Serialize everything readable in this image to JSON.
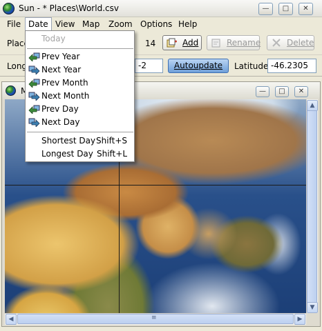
{
  "window": {
    "title": "Sun - * Places\\World.csv",
    "min_glyph": "—",
    "max_glyph": "□",
    "close_glyph": "✕"
  },
  "menubar": {
    "file": "File",
    "date": "Date",
    "view": "View",
    "map": "Map",
    "zoom": "Zoom",
    "options": "Options",
    "help": "Help"
  },
  "toolbar": {
    "place_label": "Place",
    "count": "14",
    "add_label": "Add",
    "rename_label": "Rename",
    "delete_label": "Delete"
  },
  "coords": {
    "longitude_label": "Long",
    "timezone_value": "-2",
    "autoupdate_label": "Autoupdate",
    "latitude_label": "Latitude",
    "latitude_value": "-46.2305"
  },
  "map_window": {
    "title_fragment": "M"
  },
  "date_menu": {
    "today": "Today",
    "prev_year": "Prev Year",
    "next_year": "Next Year",
    "prev_month": "Prev Month",
    "next_month": "Next Month",
    "prev_day": "Prev Day",
    "next_day": "Next Day",
    "shortest_day": "Shortest Day",
    "shortest_day_shortcut": "Shift+S",
    "longest_day": "Longest Day",
    "longest_day_shortcut": "Shift+L"
  },
  "scrollbar": {
    "up_glyph": "▲",
    "down_glyph": "▼",
    "left_glyph": "◀",
    "right_glyph": "▶",
    "grip_glyph": "≡"
  },
  "colors": {
    "menu_arrow_left": "#3c8a3c",
    "menu_arrow_right": "#3c7fb0",
    "autoupdate_active": "#6f9fd8"
  }
}
